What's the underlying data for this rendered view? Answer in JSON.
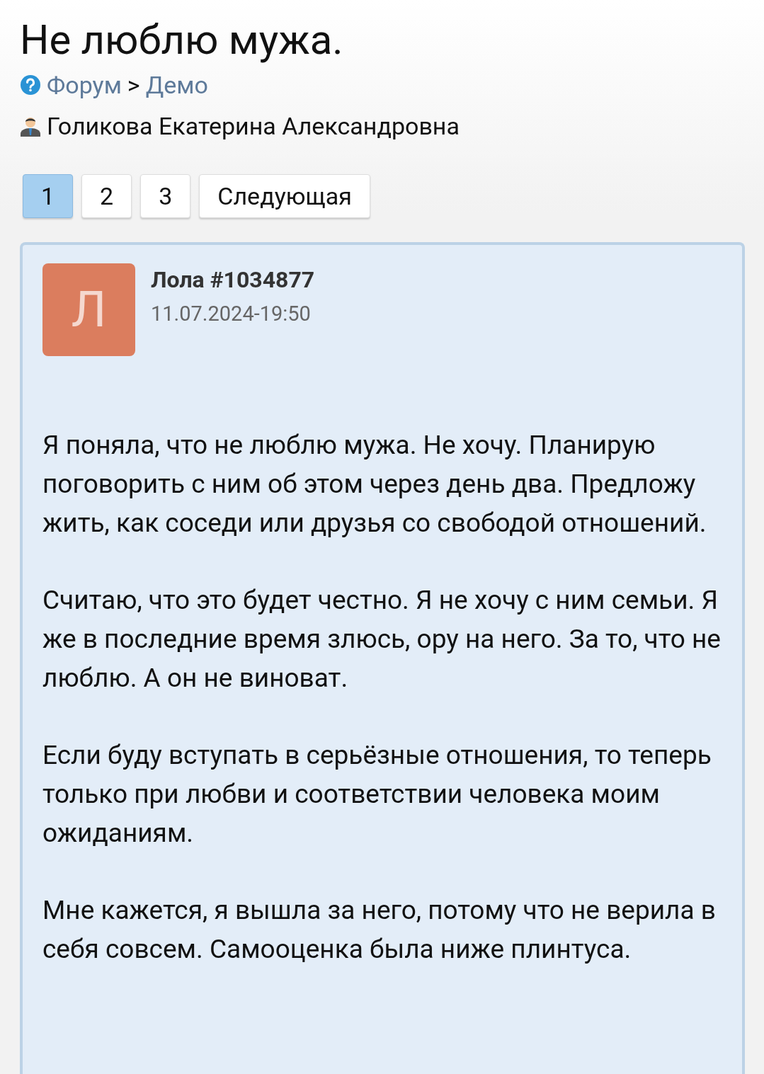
{
  "title": "Не люблю мужа.",
  "breadcrumb": {
    "items": [
      {
        "label": "Форум"
      },
      {
        "label": "Демо"
      }
    ],
    "separator": ">"
  },
  "author": "Голикова Екатерина Александровна",
  "pagination": [
    {
      "label": "1",
      "selected": true
    },
    {
      "label": "2",
      "selected": false
    },
    {
      "label": "3",
      "selected": false
    },
    {
      "label": "Следующая",
      "selected": false
    }
  ],
  "post": {
    "avatar_letter": "Л",
    "user": "Лола #1034877",
    "date": "11.07.2024-19:50",
    "paragraphs": [
      "Я поняла, что не люблю мужа. Не хочу. Планирую поговорить с ним об этом через день два. Предложу жить, как соседи или друзья со свободой отношений.",
      "Считаю, что это будет честно. Я не хочу с ним семьи. Я же в последние время злюсь, ору на него. За то, что не люблю. А он не виноват.",
      "Если буду вступать в серьёзные отношения, то теперь только при любви и соответствии человека моим ожиданиям.",
      "Мне кажется, я вышла за него, потому что не верила в себя совсем. Самооценка была ниже плинтуса."
    ]
  }
}
